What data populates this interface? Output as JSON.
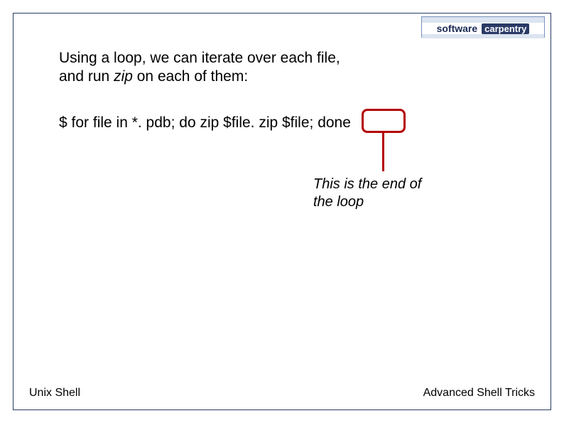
{
  "logo": {
    "top": "",
    "word1": "software",
    "word2": "carpentry",
    "bot": ""
  },
  "body": {
    "line1": "Using a loop, we can iterate over each file,",
    "line2_a": "and run ",
    "line2_ital": "zip",
    "line2_b": " on each of them:"
  },
  "command": {
    "prompt": "$ ",
    "text": "for file in *. pdb; do zip $file. zip $file; done"
  },
  "callout": {
    "line1": "This is the end of",
    "line2": "the loop"
  },
  "footer": {
    "left": "Unix Shell",
    "right": "Advanced Shell Tricks"
  }
}
